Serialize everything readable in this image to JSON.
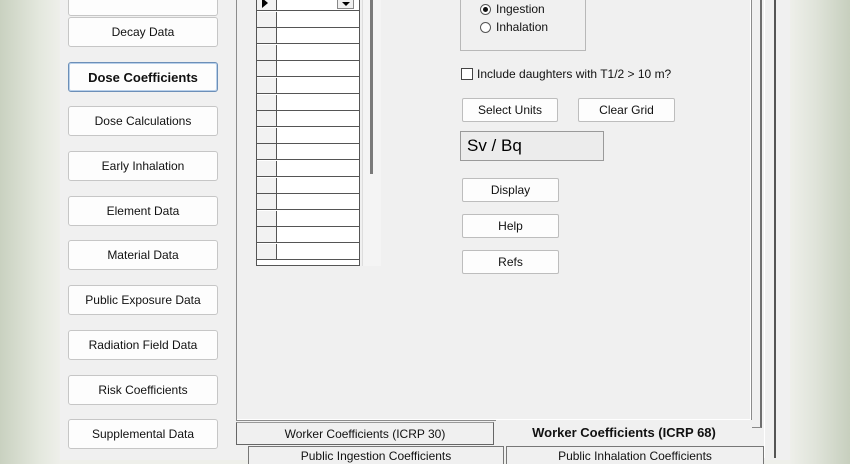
{
  "sidebar": {
    "items": [
      {
        "label": ""
      },
      {
        "label": "Decay Data"
      },
      {
        "label": "Dose Coefficients"
      },
      {
        "label": "Dose Calculations"
      },
      {
        "label": "Early Inhalation"
      },
      {
        "label": "Element Data"
      },
      {
        "label": "Material Data"
      },
      {
        "label": "Public Exposure Data"
      },
      {
        "label": "Radiation Field Data"
      },
      {
        "label": "Risk Coefficients"
      },
      {
        "label": "Supplemental Data"
      }
    ]
  },
  "intake": {
    "ingestion_label": "Ingestion",
    "inhalation_label": "Inhalation",
    "selected": "Ingestion"
  },
  "options": {
    "include_daughters_label": "Include daughters with T1/2 > 10 m?",
    "include_daughters_checked": false
  },
  "buttons": {
    "select_units": "Select Units",
    "clear_grid": "Clear Grid",
    "display": "Display",
    "help": "Help",
    "refs": "Refs"
  },
  "units_display": "Sv  / Bq",
  "tabs": {
    "worker_icrp30": "Worker Coefficients  (ICRP 30)",
    "worker_icrp68": "Worker Coefficients (ICRP 68)",
    "public_ingestion": "Public Ingestion Coefficients",
    "public_inhalation": "Public Inhalation Coefficients"
  },
  "icons": {
    "row_indicator": "current-row-arrow-icon",
    "dropdown": "dropdown-arrow-icon"
  }
}
